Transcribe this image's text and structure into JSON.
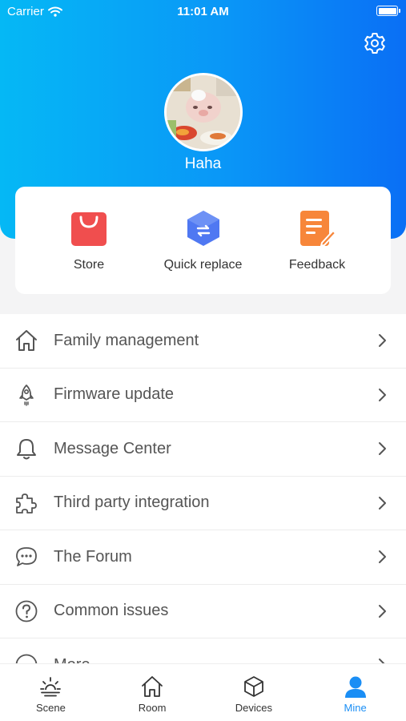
{
  "status_bar": {
    "carrier": "Carrier",
    "time": "11:01 AM"
  },
  "profile": {
    "name": "Haha"
  },
  "quick_actions": [
    {
      "label": "Store",
      "icon": "shopping-bag-icon",
      "color": "#f04e4e"
    },
    {
      "label": "Quick replace",
      "icon": "replace-cube-icon",
      "color": "#4f78f2"
    },
    {
      "label": "Feedback",
      "icon": "feedback-edit-icon",
      "color": "#f7863a"
    }
  ],
  "menu": [
    {
      "label": "Family management",
      "icon": "home-icon"
    },
    {
      "label": "Firmware update",
      "icon": "rocket-icon"
    },
    {
      "label": "Message Center",
      "icon": "bell-icon"
    },
    {
      "label": "Third party integration",
      "icon": "puzzle-icon"
    },
    {
      "label": "The Forum",
      "icon": "chat-bubble-icon"
    },
    {
      "label": "Common issues",
      "icon": "question-icon"
    },
    {
      "label": "More",
      "icon": "more-icon"
    }
  ],
  "tabs": [
    {
      "label": "Scene",
      "icon": "sunrise-icon",
      "active": false
    },
    {
      "label": "Room",
      "icon": "home-icon",
      "active": false
    },
    {
      "label": "Devices",
      "icon": "cube-icon",
      "active": false
    },
    {
      "label": "Mine",
      "icon": "person-icon",
      "active": true
    }
  ],
  "colors": {
    "accent": "#1a8ef5",
    "header_start": "#05b8f5",
    "header_end": "#0a6ff5"
  }
}
